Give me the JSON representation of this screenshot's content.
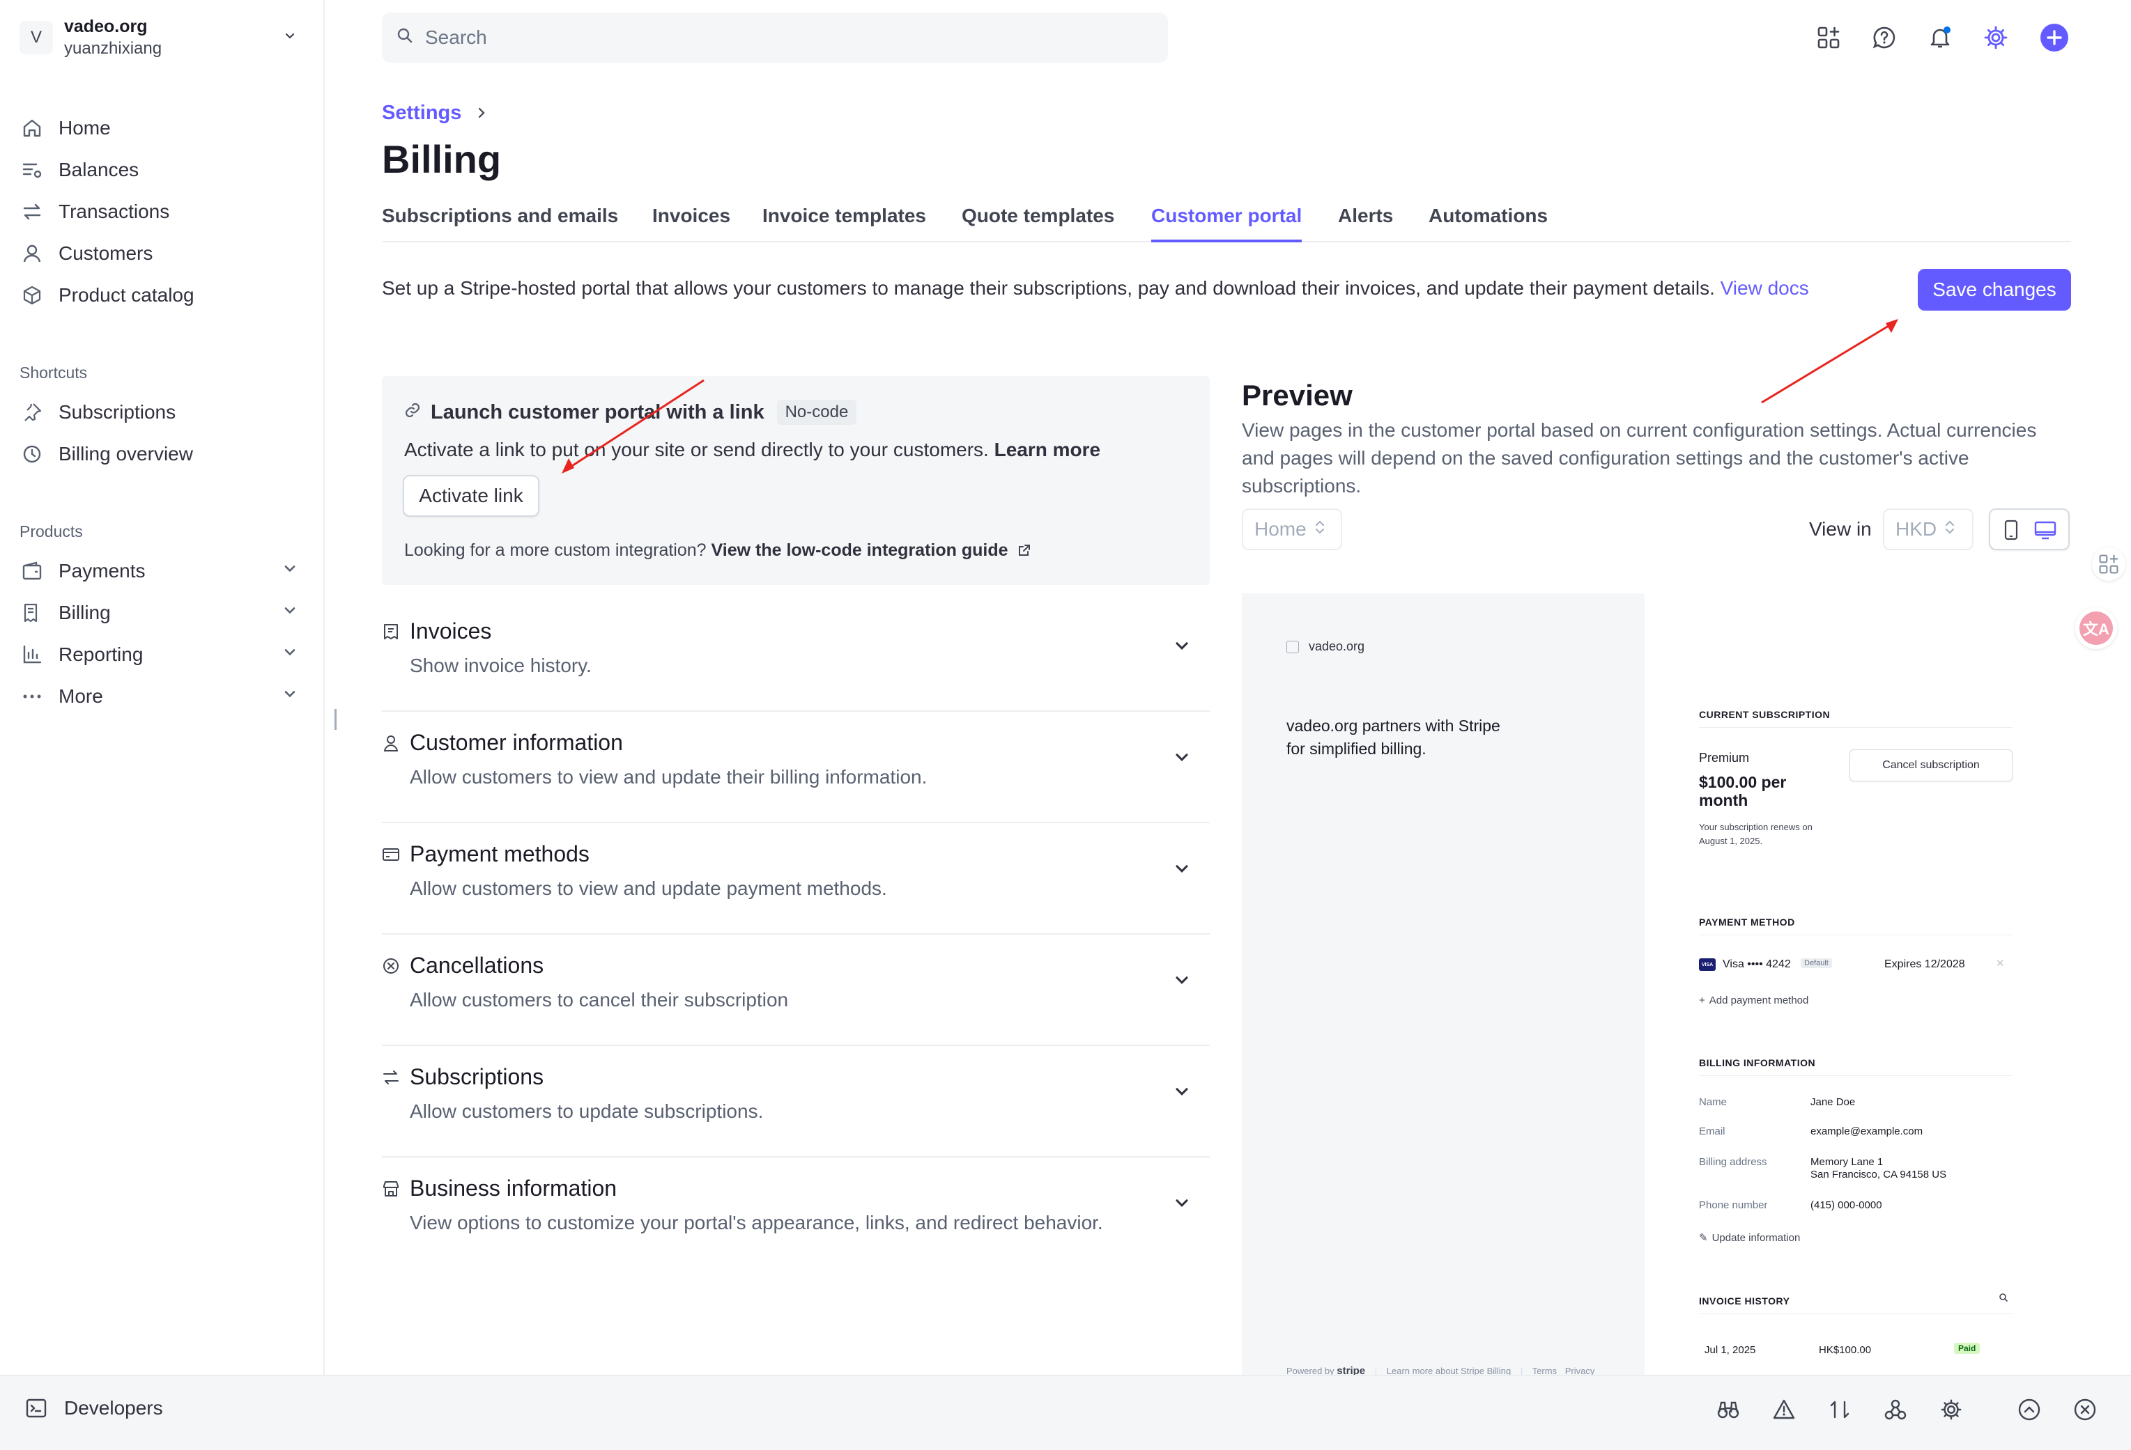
{
  "account": {
    "badge": "V",
    "name": "vadeo.org",
    "user": "yuanzhixiang"
  },
  "sidebar": {
    "main": [
      {
        "label": "Home",
        "icon": "home-icon"
      },
      {
        "label": "Balances",
        "icon": "balances-icon"
      },
      {
        "label": "Transactions",
        "icon": "transactions-icon"
      },
      {
        "label": "Customers",
        "icon": "customers-icon"
      },
      {
        "label": "Product catalog",
        "icon": "product-catalog-icon"
      }
    ],
    "shortcuts_label": "Shortcuts",
    "shortcuts": [
      {
        "label": "Subscriptions",
        "icon": "subscriptions-icon"
      },
      {
        "label": "Billing overview",
        "icon": "billing-overview-icon"
      }
    ],
    "products_label": "Products",
    "products": [
      {
        "label": "Payments",
        "icon": "payments-icon"
      },
      {
        "label": "Billing",
        "icon": "billing-icon"
      },
      {
        "label": "Reporting",
        "icon": "reporting-icon"
      },
      {
        "label": "More",
        "icon": "more-icon"
      }
    ]
  },
  "search": {
    "placeholder": "Search"
  },
  "header": {
    "breadcrumb": "Settings",
    "title": "Billing",
    "tabs": [
      "Subscriptions and emails",
      "Invoices",
      "Invoice templates",
      "Quote templates",
      "Customer portal",
      "Alerts",
      "Automations"
    ],
    "active_tab": "Customer portal"
  },
  "intro": {
    "text": "Set up a Stripe-hosted portal that allows your customers to manage their subscriptions, pay and download their invoices, and update their payment details.",
    "link": "View docs"
  },
  "save_button": "Save changes",
  "launch": {
    "title": "Launch customer portal with a link",
    "badge": "No-code",
    "desc": "Activate a link to put on your site or send directly to your customers.",
    "learn_more": "Learn more",
    "button": "Activate link",
    "footer": "Looking for a more custom integration?",
    "footer_link": "View the low-code integration guide"
  },
  "sections": [
    {
      "title": "Invoices",
      "desc": "Show invoice history."
    },
    {
      "title": "Customer information",
      "desc": "Allow customers to view and update their billing information."
    },
    {
      "title": "Payment methods",
      "desc": "Allow customers to view and update payment methods."
    },
    {
      "title": "Cancellations",
      "desc": "Allow customers to cancel their subscription"
    },
    {
      "title": "Subscriptions",
      "desc": "Allow customers to update subscriptions."
    },
    {
      "title": "Business information",
      "desc": "View options to customize your portal's appearance, links, and redirect behavior."
    }
  ],
  "preview": {
    "title": "Preview",
    "desc": "View pages in the customer portal based on current configuration settings. Actual currencies and pages will depend on the saved configuration settings and the customer's active subscriptions.",
    "page_select": "Home",
    "view_in_label": "View in",
    "currency_select": "HKD",
    "portal": {
      "logo": "vadeo.org",
      "tagline": "vadeo.org partners with Stripe for simplified billing.",
      "footer_powered": "Powered by",
      "footer_brand": "stripe",
      "footer_learn": "Learn more about Stripe Billing",
      "footer_terms": "Terms",
      "footer_privacy": "Privacy",
      "current_subscription_h": "CURRENT SUBSCRIPTION",
      "plan": "Premium",
      "price": "$100.00 per month",
      "renews": "Your subscription renews on August 1, 2025.",
      "cancel_button": "Cancel subscription",
      "payment_method_h": "PAYMENT METHOD",
      "card": "Visa •••• 4242",
      "card_brand": "VISA",
      "default_badge": "Default",
      "expires": "Expires 12/2028",
      "add_payment": "Add payment method",
      "billing_info_h": "BILLING INFORMATION",
      "fields": [
        {
          "label": "Name",
          "value": "Jane Doe"
        },
        {
          "label": "Email",
          "value": "example@example.com"
        },
        {
          "label": "Billing address",
          "value": "Memory Lane 1",
          "value2": "San Francisco, CA 94158 US"
        },
        {
          "label": "Phone number",
          "value": "(415) 000-0000"
        }
      ],
      "update_info": "Update information",
      "invoice_history_h": "INVOICE HISTORY",
      "invoice": {
        "date": "Jul 1, 2025",
        "amount": "HK$100.00",
        "status": "Paid"
      }
    }
  },
  "bottom": {
    "developers": "Developers"
  },
  "colors": {
    "accent": "#635bff",
    "annotation_arrow": "#e8251f"
  }
}
